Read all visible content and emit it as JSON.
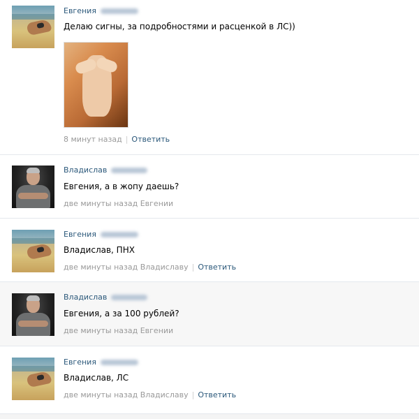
{
  "comments": [
    {
      "author": "Евгения",
      "text": "Делаю сигны, за подробностями и расценкой в ЛС))",
      "time": "8 минут назад",
      "separator": "|",
      "reply": "Ответить",
      "avatar_icon": "beach-woman-avatar",
      "has_photo": true
    },
    {
      "author": "Владислав",
      "text": "Евгения, а в жопу даешь?",
      "time": "две минуты назад Евгении",
      "avatar_icon": "man-avatar"
    },
    {
      "author": "Евгения",
      "text": "Владислав, ПНХ",
      "time": "две минуты назад Владиславу",
      "separator": "|",
      "reply": "Ответить",
      "avatar_icon": "beach-woman-avatar"
    },
    {
      "author": "Владислав",
      "text": "Евгения, а за 100 рублей?",
      "time": "две минуты назад Евгении",
      "avatar_icon": "man-avatar"
    },
    {
      "author": "Евгения",
      "text": "Владислав, ЛС",
      "time": "две минуты назад Владиславу",
      "separator": "|",
      "reply": "Ответить",
      "avatar_icon": "beach-woman-avatar"
    }
  ],
  "colors": {
    "link": "#2b587a",
    "meta": "#999999",
    "divider": "#e4e8ed"
  }
}
